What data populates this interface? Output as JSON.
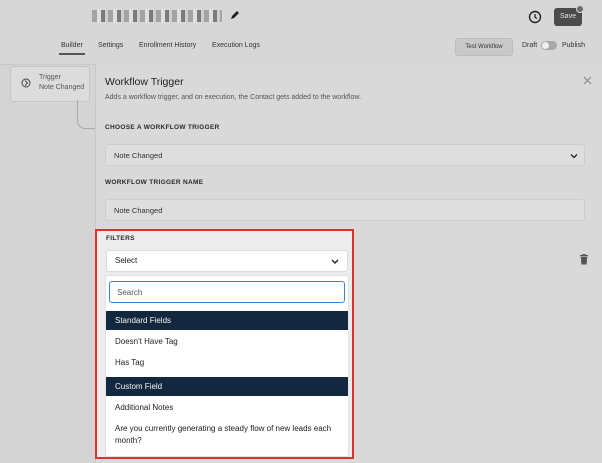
{
  "header": {
    "save_label": "Save",
    "tabs": [
      {
        "label": "Builder",
        "active": true
      },
      {
        "label": "Settings",
        "active": false
      },
      {
        "label": "Enrollment History",
        "active": false
      },
      {
        "label": "Execution Logs",
        "active": false
      }
    ],
    "test_label": "Test Workflow",
    "draft_label": "Draft",
    "publish_label": "Publish"
  },
  "canvas": {
    "trigger_title": "Trigger",
    "trigger_subtitle": "Note Changed"
  },
  "panel": {
    "title": "Workflow Trigger",
    "description": "Adds a workflow trigger, and on execution, the Contact gets added to the workflow.",
    "choose_label": "CHOOSE A WORKFLOW TRIGGER",
    "choose_value": "Note Changed",
    "name_label": "WORKFLOW TRIGGER NAME",
    "name_value": "Note Changed",
    "filters_label": "FILTERS",
    "select_value": "Select",
    "search_placeholder": "Search",
    "groups": [
      {
        "label": "Standard Fields",
        "options": [
          "Doesn't Have Tag",
          "Has Tag"
        ]
      },
      {
        "label": "Custom Field",
        "options": [
          "Additional Notes",
          "Are you currently generating a steady flow of new leads each month?"
        ]
      }
    ]
  },
  "colors": {
    "highlight_border": "#e0312b",
    "group_header_bg": "#13283e",
    "search_focus": "#3b82d6"
  }
}
